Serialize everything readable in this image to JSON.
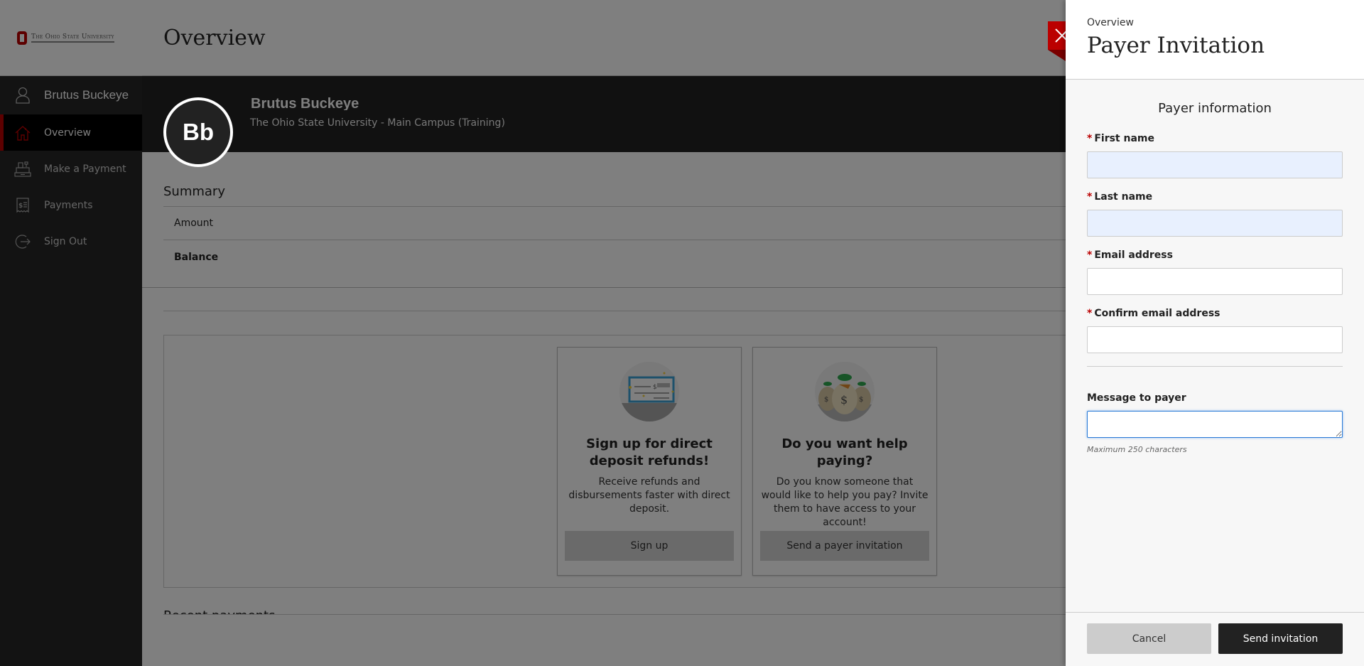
{
  "brand": {
    "name": "The Ohio State University",
    "accent": "#bb0000"
  },
  "sidebar": {
    "user": {
      "name": "Brutus Buckeye",
      "icon": "user-icon"
    },
    "items": [
      {
        "label": "Overview",
        "icon": "home-icon",
        "active": true
      },
      {
        "label": "Make a Payment",
        "icon": "cash-register-icon",
        "active": false
      },
      {
        "label": "Payments",
        "icon": "receipt-icon",
        "active": false
      },
      {
        "label": "Sign Out",
        "icon": "sign-out-icon",
        "active": false
      }
    ]
  },
  "header": {
    "title": "Overview"
  },
  "profile": {
    "initials": "Bb",
    "name": "Brutus Buckeye",
    "institution": "The Ohio State University - Main Campus (Training)"
  },
  "summary": {
    "title": "Summary",
    "rows": [
      {
        "label": "Amount"
      },
      {
        "label": "Balance"
      }
    ]
  },
  "cards": [
    {
      "illustration": "check-icon",
      "title": "Sign up for direct deposit refunds!",
      "text": "Receive refunds and disbursements faster with direct deposit.",
      "button": "Sign up"
    },
    {
      "illustration": "money-bags-icon",
      "title": "Do you want help paying?",
      "text": "Do you know someone that would like to help you pay? Invite them to have access to your account!",
      "button": "Send a payer invitation"
    }
  ],
  "recent": {
    "title": "Recent payments"
  },
  "panel": {
    "breadcrumb": "Overview",
    "title": "Payer Invitation",
    "section_title": "Payer information",
    "fields": {
      "first_name": {
        "label": "First name",
        "required": "*",
        "value": ""
      },
      "last_name": {
        "label": "Last name",
        "required": "*",
        "value": ""
      },
      "email": {
        "label": "Email address",
        "required": "*",
        "value": ""
      },
      "confirm_email": {
        "label": "Confirm email address",
        "required": "*",
        "value": ""
      },
      "message": {
        "label": "Message to payer",
        "value": "",
        "hint": "Maximum 250 characters"
      }
    },
    "cancel_label": "Cancel",
    "send_label": "Send invitation"
  }
}
